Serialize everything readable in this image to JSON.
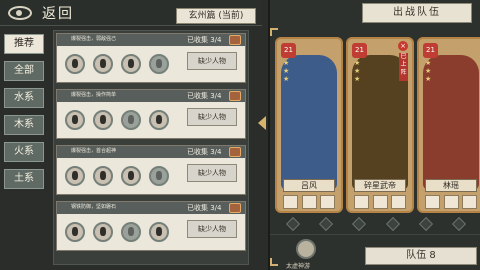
{
  "ui": {
    "back": "返回",
    "chapter": "玄州篇 (当前)",
    "team_title": "出战队伍",
    "team_number": "队伍 8",
    "character_label": "太虚神游"
  },
  "tabs": [
    {
      "label": "推荐",
      "active": true
    },
    {
      "label": "全部",
      "active": false
    },
    {
      "label": "水系",
      "active": false
    },
    {
      "label": "木系",
      "active": false
    },
    {
      "label": "火系",
      "active": false
    },
    {
      "label": "土系",
      "active": false
    }
  ],
  "collections": [
    {
      "desc": "爆裂强击，弱敌强己",
      "count": "已收集 3/4",
      "button": "缺少人物"
    },
    {
      "desc": "爆裂强击，操作简单",
      "count": "已收集 3/4",
      "button": "缺少人物"
    },
    {
      "desc": "爆裂强击，首合超神",
      "count": "已收集 3/4",
      "button": "缺少人物"
    },
    {
      "desc": "钢铁防御，坚如磐石",
      "count": "已收集 3/4",
      "button": "缺少人物"
    }
  ],
  "heroes": [
    {
      "name": "吕风",
      "level": "21",
      "color": "#3d5c89"
    },
    {
      "name": "碎星武帝",
      "level": "21",
      "color": "#55411f"
    },
    {
      "name": "林瑶",
      "level": "21",
      "color": "#8a3c2d"
    }
  ],
  "hero_tag": "已上阵"
}
